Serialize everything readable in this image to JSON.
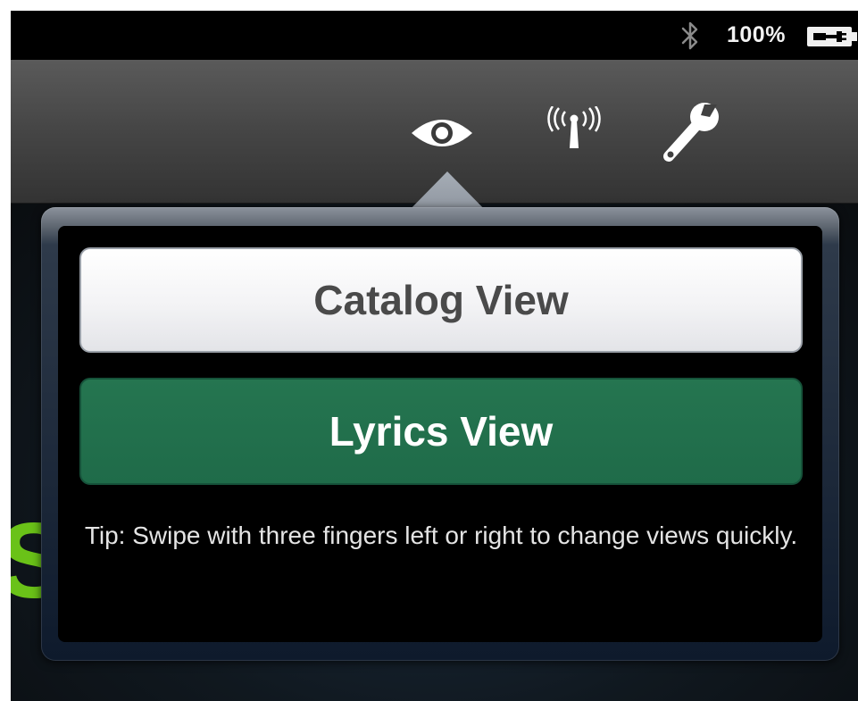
{
  "status_bar": {
    "battery_percent": "100%",
    "bluetooth_icon": "bluetooth-icon",
    "battery_icon": "battery-charging-icon"
  },
  "toolbar": {
    "icons": [
      "eye-icon",
      "wireless-antenna-icon",
      "wrench-icon"
    ]
  },
  "popover": {
    "catalog_button_label": "Catalog View",
    "lyrics_button_label": "Lyrics View",
    "tip_text": "Tip: Swipe with three fingers left or right to change views quickly.",
    "selected": "Lyrics View"
  },
  "colors": {
    "selected_button": "#216e4b",
    "background_letter": "#6ac218"
  }
}
